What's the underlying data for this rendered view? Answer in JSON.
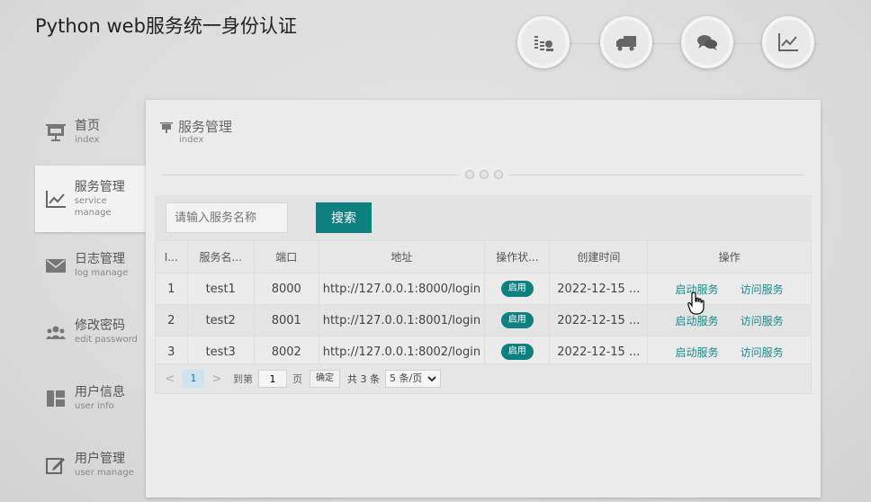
{
  "app": {
    "title": "Python web服务统一身份认证"
  },
  "top_icons": [
    "coins-icon",
    "truck-icon",
    "chat-icon",
    "line-chart-icon"
  ],
  "sidebar": {
    "items": [
      {
        "cn": "首页",
        "en": "index",
        "icon": "presentation-icon"
      },
      {
        "cn": "服务管理",
        "en": "service manage",
        "icon": "line-chart-icon"
      },
      {
        "cn": "日志管理",
        "en": "log manage",
        "icon": "envelope-icon"
      },
      {
        "cn": "修改密码",
        "en": "edit password",
        "icon": "users-icon"
      },
      {
        "cn": "用户信息",
        "en": "user info",
        "icon": "layout-icon"
      },
      {
        "cn": "用户管理",
        "en": "user manage",
        "icon": "edit-icon"
      }
    ]
  },
  "panel": {
    "title": "服务管理",
    "subtitle": "index"
  },
  "search": {
    "placeholder": "请输入服务名称",
    "button": "搜索"
  },
  "table": {
    "headers": [
      "I...",
      "服务名...",
      "端口",
      "地址",
      "操作状...",
      "创建时间",
      "操作"
    ],
    "rows": [
      {
        "id": "1",
        "name": "test1",
        "port": "8000",
        "url": "http://127.0.0.1:8000/login",
        "status": "启用",
        "created": "2022-12-15 ...",
        "op1": "启动服务",
        "op2": "访问服务"
      },
      {
        "id": "2",
        "name": "test2",
        "port": "8001",
        "url": "http://127.0.0.1:8001/login",
        "status": "启用",
        "created": "2022-12-15 ...",
        "op1": "启动服务",
        "op2": "访问服务"
      },
      {
        "id": "3",
        "name": "test3",
        "port": "8002",
        "url": "http://127.0.0.1:8002/login",
        "status": "启用",
        "created": "2022-12-15 ...",
        "op1": "启动服务",
        "op2": "访问服务"
      }
    ]
  },
  "pager": {
    "prev": "<",
    "current": "1",
    "next": ">",
    "goto_label": "到第",
    "goto_value": "1",
    "page_label": "页",
    "confirm": "确定",
    "total": "共 3 条",
    "page_size": "5 条/页"
  },
  "colors": {
    "accent": "#0e8080",
    "link": "#1a8a8a"
  }
}
